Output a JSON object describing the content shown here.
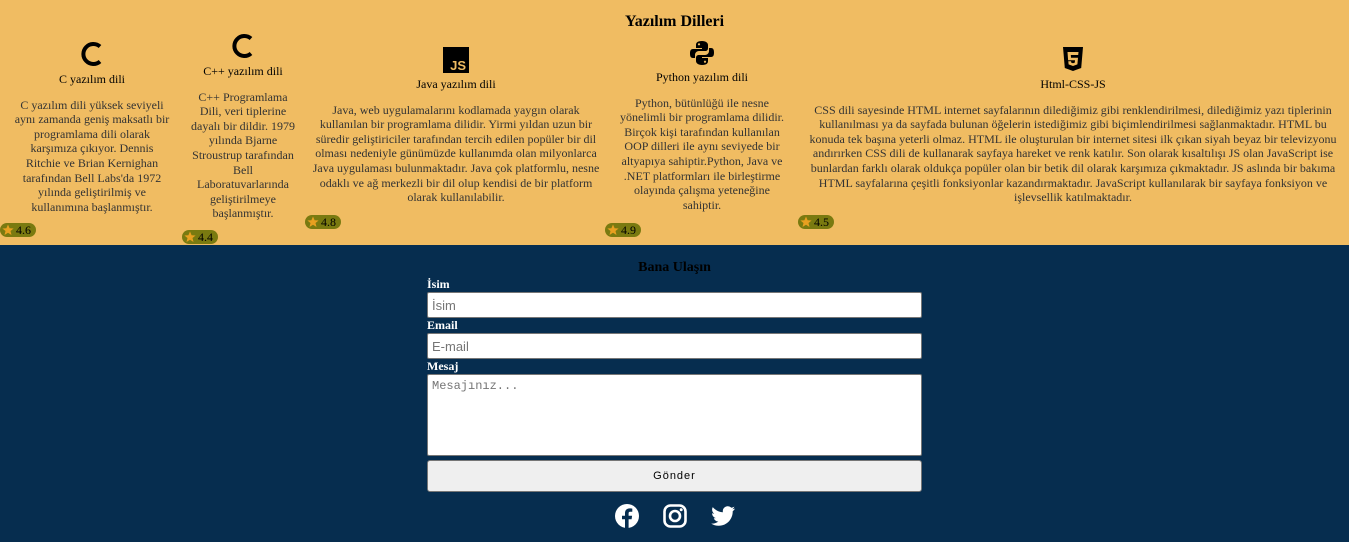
{
  "languages": {
    "title": "Yazılım Dilleri",
    "cards": [
      {
        "name": "C yazılım dili",
        "icon": "c-logo-icon",
        "desc": "C yazılım dili yüksek seviyeli aynı zamanda geniş maksatlı bir programlama dili olarak karşımıza çıkıyor. Dennis Ritchie ve Brian Kernighan tarafından Bell Labs'da 1972 yılında geliştirilmiş ve kullanımına başlanmıştır.",
        "rating": "4.6"
      },
      {
        "name": "C++ yazılım dili",
        "icon": "cpp-logo-icon",
        "desc": "C++ Programlama Dili, veri tiplerine dayalı bir dildir. 1979 yılında Bjarne Stroustrup tarafından Bell Laboratuvarlarında geliştirilmeye başlanmıştır.",
        "rating": "4.4"
      },
      {
        "name": "Java yazılım dili",
        "icon": "js-logo-icon",
        "desc": "Java, web uygulamalarını kodlamada yaygın olarak kullanılan bir programlama dilidir. Yirmi yıldan uzun bir süredir geliştiriciler tarafından tercih edilen popüler bir dil olması nedeniyle günümüzde kullanımda olan milyonlarca Java uygulaması bulunmaktadır. Java çok platformlu, nesne odaklı ve ağ merkezli bir dil olup kendisi de bir platform olarak kullanılabilir.",
        "rating": "4.8"
      },
      {
        "name": "Python yazılım dili",
        "icon": "python-logo-icon",
        "desc": "Python, bütünlüğü ile nesne yönelimli bir programlama dilidir. Birçok kişi tarafından kullanılan OOP dilleri ile aynı seviyede bir altyapıya sahiptir.Python, Java ve .NET platformları ile birleştirme olayında çalışma yeteneğine sahiptir.",
        "rating": "4.9"
      },
      {
        "name": "Html-CSS-JS",
        "icon": "html5-logo-icon",
        "desc": "CSS dili sayesinde HTML internet sayfalarının dilediğimiz gibi renklendirilmesi, dilediğimiz yazı tiplerinin kullanılması ya da sayfada bulunan öğelerin istediğimiz gibi biçimlendirilmesi sağlanmaktadır. HTML bu konuda tek başına yeterli olmaz. HTML ile oluşturulan bir internet sitesi ilk çıkan siyah beyaz bir televizyonu andırırken CSS dili de kullanarak sayfaya hareket ve renk katılır. Son olarak kısaltılışı JS olan JavaScript ise bunlardan farklı olarak oldukça popüler olan bir betik dil olarak karşımıza çıkmaktadır. JS aslında bir bakıma HTML sayfalarına çeşitli fonksiyonlar kazandırmaktadır. JavaScript kullanılarak bir sayfaya fonksiyon ve işlevsellik katılmaktadır.",
        "rating": "4.5"
      }
    ]
  },
  "contact": {
    "title": "Bana Ulaşın",
    "name_label": "İsim",
    "name_placeholder": "İsim",
    "email_label": "Email",
    "email_placeholder": "E-mail",
    "message_label": "Mesaj",
    "message_placeholder": "Mesajınız...",
    "submit_label": "Gönder"
  },
  "socials": [
    "facebook-icon",
    "instagram-icon",
    "twitter-icon"
  ],
  "colors": {
    "top_bg": "#f0bc62",
    "bottom_bg": "#062d4f",
    "rating_bg": "#7a7a10",
    "star": "#e8a020"
  }
}
